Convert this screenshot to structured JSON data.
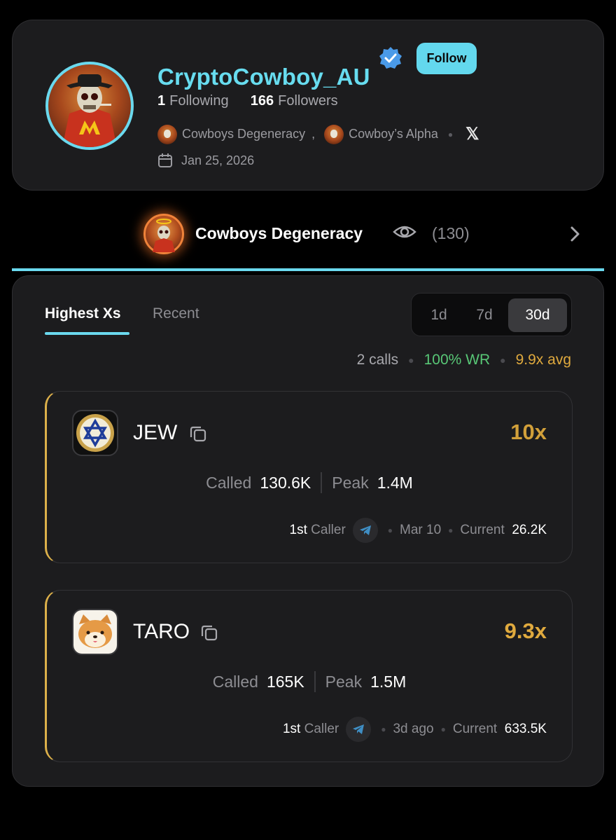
{
  "profile": {
    "username": "CryptoCowboy_AU",
    "follow_label": "Follow",
    "following_count": "1",
    "following_label": "Following",
    "followers_count": "166",
    "followers_label": "Followers",
    "groups": [
      "Cowboys Degeneracy",
      "Cowboy’s Alpha"
    ],
    "group_separator": ",",
    "date": "Jan 25, 2026"
  },
  "community": {
    "name": "Cowboys Degeneracy",
    "watchers": "(130)"
  },
  "tabs": {
    "highest": "Highest Xs",
    "recent": "Recent"
  },
  "ranges": [
    "1d",
    "7d",
    "30d"
  ],
  "selected_range": "30d",
  "summary": {
    "calls": "2 calls",
    "win_rate": "100% WR",
    "avg": "9.9x avg"
  },
  "calls": [
    {
      "token": "JEW",
      "multiple": "10x",
      "called_label": "Called",
      "called": "130.6K",
      "peak_label": "Peak",
      "peak": "1.4M",
      "rank": "1st",
      "caller_label": "Caller",
      "when": "Mar 10",
      "current_label": "Current",
      "current": "26.2K"
    },
    {
      "token": "TARO",
      "multiple": "9.3x",
      "called_label": "Called",
      "called": "165K",
      "peak_label": "Peak",
      "peak": "1.5M",
      "rank": "1st",
      "caller_label": "Caller",
      "when": "3d ago",
      "current_label": "Current",
      "current": "633.5K"
    }
  ],
  "colors": {
    "accent": "#67dcef",
    "gold": "#e0aa3e",
    "green": "#58c776",
    "card_bg": "#1c1c1e"
  },
  "icons": [
    "verified-badge-icon",
    "calendar-icon",
    "x-logo-icon",
    "eye-icon",
    "chevron-right-icon",
    "copy-icon",
    "telegram-icon"
  ]
}
